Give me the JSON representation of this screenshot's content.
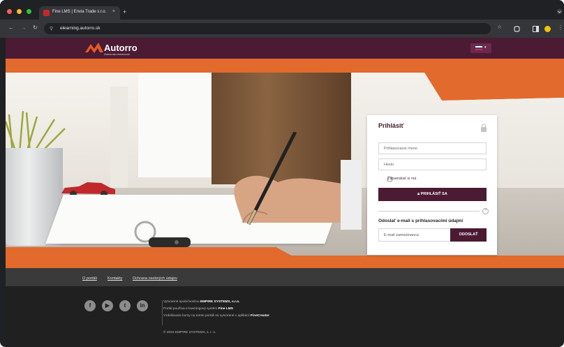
{
  "browser": {
    "tab_title": "Fine LMS | Envia Trade s.r.o.",
    "tab_close": "×",
    "new_tab": "+",
    "url": "elearning.autorro.sk",
    "colors": {
      "frame": "#202124",
      "toolbar": "#35363a"
    }
  },
  "site": {
    "brand": "Autorro",
    "tagline": "Zmena ako motorizovat",
    "colors": {
      "primary": "#4b1a33",
      "accent": "#e26a2c"
    }
  },
  "login": {
    "title": "Prihlásiť",
    "username_placeholder": "Prihlasovacie meno",
    "password_placeholder": "Heslo",
    "remember_label": "Zapamätať si ma",
    "login_button": "PRIHLÁSIŤ SA",
    "help_icon": "?",
    "send_label": "Odoslať e-mail s prihlasovacími údajmi",
    "email_placeholder": "E-mail zamestnanca",
    "send_button": "ODOSLAŤ"
  },
  "footer_links": [
    "O portáli",
    "Kontakty",
    "Ochrana osobných údajov"
  ],
  "footer": {
    "social": [
      "f",
      "▶",
      "t",
      "in"
    ],
    "line1_prefix": "Vytvorené spoločnosťou ",
    "line1_bold": "EMPIRE SYSTEMS, s.r.o.",
    "line2_prefix": "Portál používa e-learningový systém ",
    "line2_bold": "Fine LMS",
    "line3_prefix": "Vzdelávacie kurzy na tomto portáli sú vytvorené v aplikácii ",
    "line3_bold": "FineCreator",
    "copyright": "© 2024 EMPIRE SYSTEMS, s. r. o."
  }
}
